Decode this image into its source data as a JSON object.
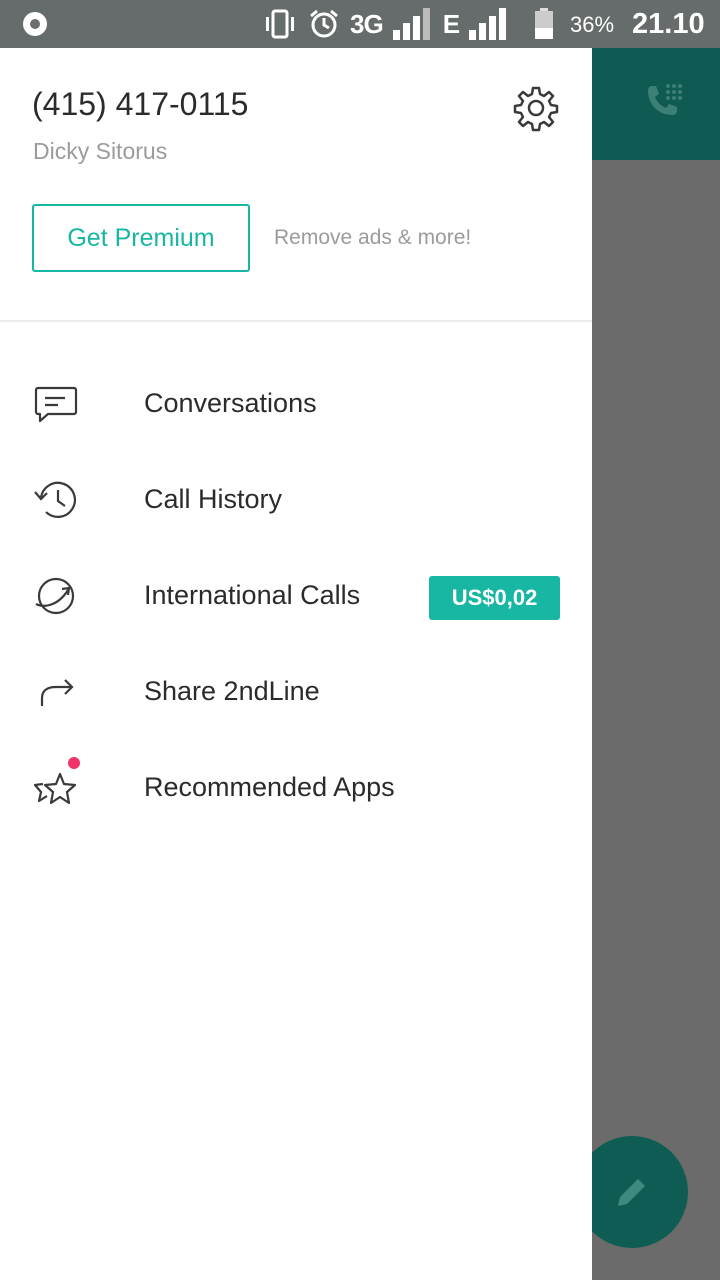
{
  "status_bar": {
    "network": "3G",
    "network2": "E",
    "battery": "36%",
    "time": "21.10"
  },
  "drawer": {
    "phone_number": "(415) 417-0115",
    "user_name": "Dicky Sitorus",
    "premium_button": "Get Premium",
    "premium_note": "Remove ads & more!",
    "menu": [
      {
        "label": "Conversations",
        "icon": "chat-bubble-icon"
      },
      {
        "label": "Call History",
        "icon": "history-icon"
      },
      {
        "label": "International Calls",
        "icon": "globe-call-icon",
        "badge": "US$0,02"
      },
      {
        "label": "Share 2ndLine",
        "icon": "share-arrow-icon"
      },
      {
        "label": "Recommended Apps",
        "icon": "stars-icon"
      }
    ]
  },
  "colors": {
    "accent": "#17b7a4",
    "toolbar": "#0f5a52",
    "notification_dot": "#f0336a"
  }
}
